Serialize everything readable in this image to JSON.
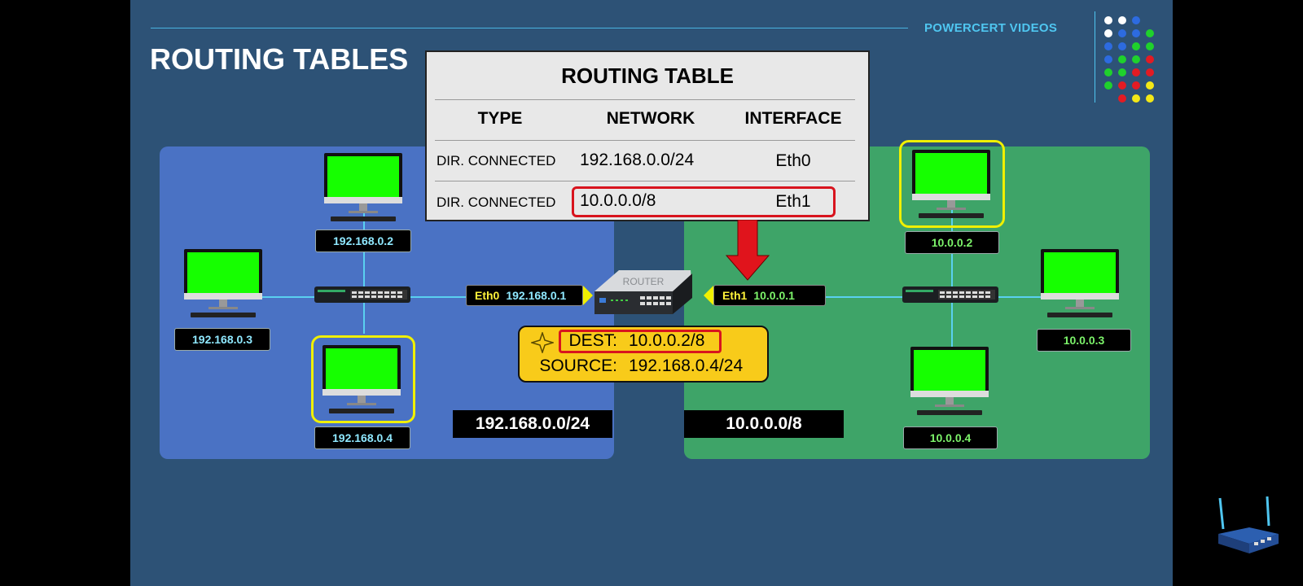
{
  "header": {
    "title": "ROUTING TABLES",
    "brand": "POWERCERT VIDEOS"
  },
  "routing_table": {
    "title": "ROUTING TABLE",
    "columns": [
      "TYPE",
      "NETWORK",
      "INTERFACE"
    ],
    "rows": [
      {
        "type": "DIR. CONNECTED",
        "network": "192.168.0.0/24",
        "interface": "Eth0"
      },
      {
        "type": "DIR. CONNECTED",
        "network": "10.0.0.0/8",
        "interface": "Eth1"
      }
    ],
    "highlighted_row": 2
  },
  "router": {
    "label": "ROUTER",
    "eth0": {
      "name": "Eth0",
      "ip": "192.168.0.1"
    },
    "eth1": {
      "name": "Eth1",
      "ip": "10.0.0.1"
    }
  },
  "packet": {
    "dest_label": "DEST:",
    "dest_value": "10.0.0.2/8",
    "source_label": "SOURCE:",
    "source_value": "192.168.0.4/24"
  },
  "left_network": {
    "label": "192.168.0.0/24",
    "hosts": [
      "192.168.0.2",
      "192.168.0.3",
      "192.168.0.4"
    ],
    "selected_host": "192.168.0.4"
  },
  "right_network": {
    "label": "10.0.0.0/8",
    "hosts": [
      "10.0.0.2",
      "10.0.0.3",
      "10.0.0.4"
    ],
    "selected_host": "10.0.0.2"
  },
  "colors": {
    "background": "#2d5276",
    "left_lan": "#4a72c4",
    "right_lan": "#3ea468",
    "highlight_yellow": "#f0f000",
    "highlight_red": "#d8141e",
    "packet_yellow": "#f8cb1a",
    "brand_cyan": "#4fc6f0"
  },
  "icons": [
    "monitor-icon",
    "switch-icon",
    "router-icon",
    "arrow-down-icon",
    "wireless-router-icon",
    "brand-dots-logo"
  ]
}
